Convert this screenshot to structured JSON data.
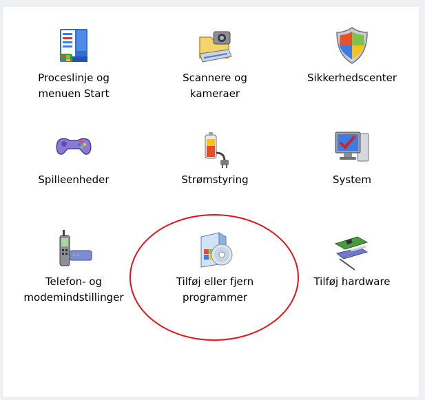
{
  "items": [
    {
      "id": "proceslinje",
      "lines": [
        "Proceslinje og",
        "menuen Start"
      ],
      "icon": "taskbar-start-icon"
    },
    {
      "id": "scannere",
      "lines": [
        "Scannere og",
        "kameraer"
      ],
      "icon": "scanner-camera-icon"
    },
    {
      "id": "sikkerhed",
      "lines": [
        "Sikkerhedscenter"
      ],
      "icon": "security-shield-icon"
    },
    {
      "id": "spilleenheder",
      "lines": [
        "Spilleenheder"
      ],
      "icon": "gamepad-icon"
    },
    {
      "id": "stroem",
      "lines": [
        "Strømstyring"
      ],
      "icon": "power-options-icon"
    },
    {
      "id": "system",
      "lines": [
        "System"
      ],
      "icon": "system-monitor-icon"
    },
    {
      "id": "telefon",
      "lines": [
        "Telefon- og",
        "modemindstillinger"
      ],
      "icon": "phone-modem-icon"
    },
    {
      "id": "tilfoej-fjern",
      "lines": [
        "Tilføj eller fjern",
        "programmer"
      ],
      "icon": "add-remove-programs-icon"
    },
    {
      "id": "tilfoej-hw",
      "lines": [
        "Tilføj hardware"
      ],
      "icon": "add-hardware-icon"
    }
  ],
  "highlight": {
    "color": "#e8101a",
    "target": "tilfoej-fjern"
  }
}
